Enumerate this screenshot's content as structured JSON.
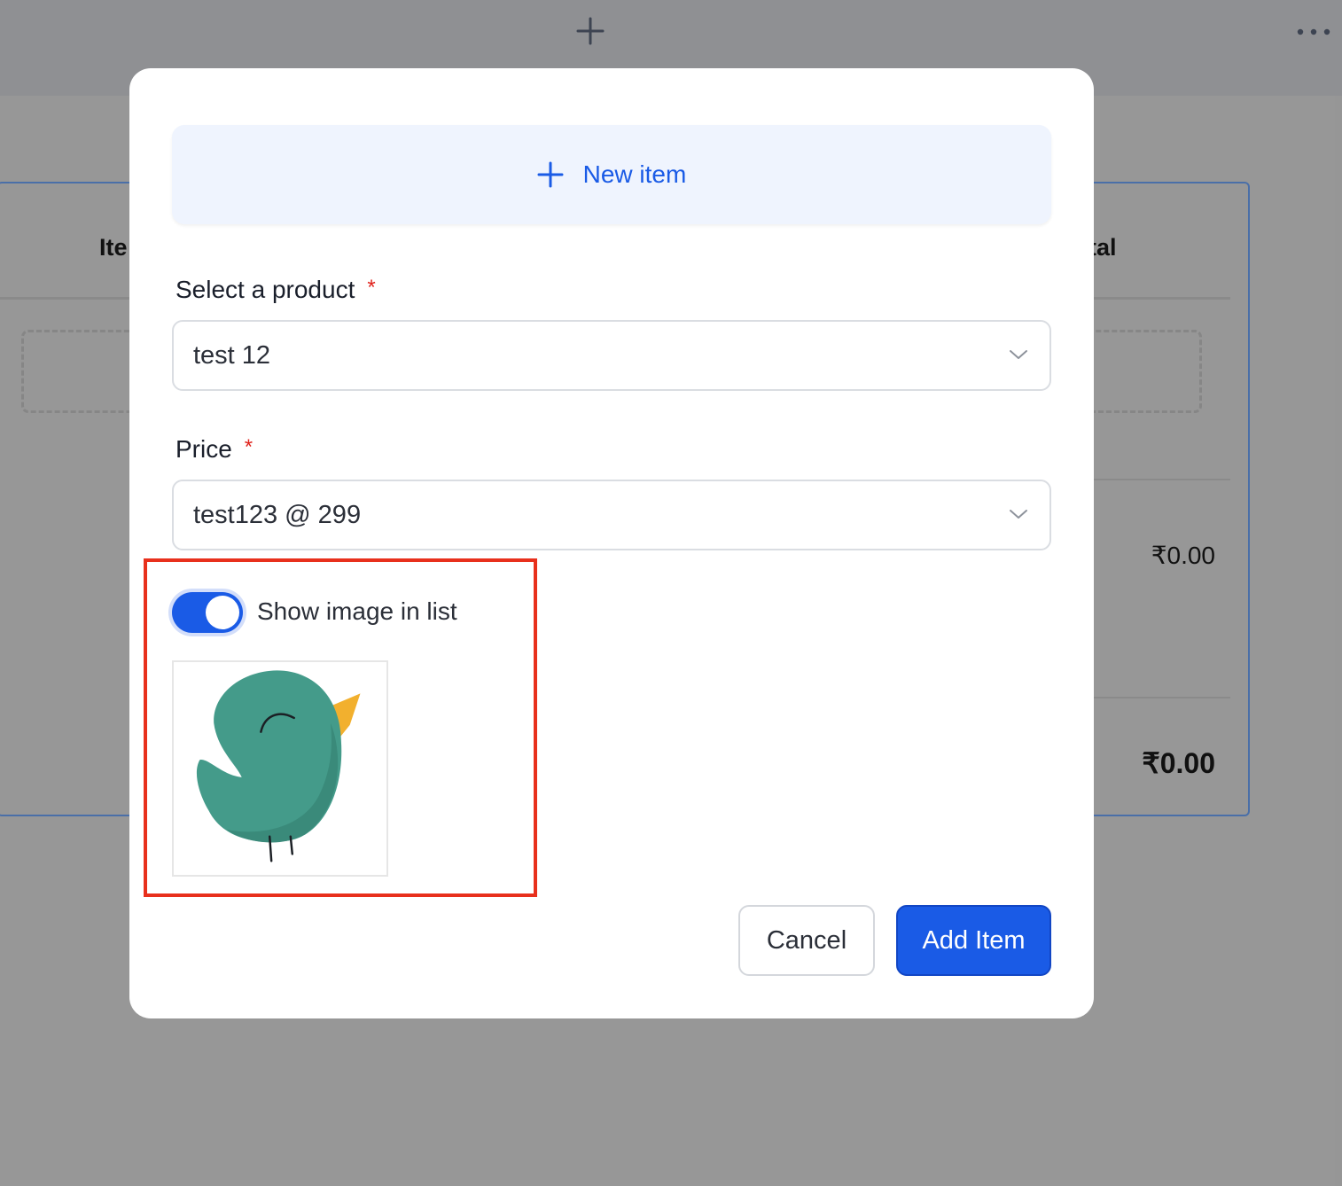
{
  "background": {
    "table_header_left": "Ite",
    "table_header_right": "tal",
    "row_amount": "₹0.00",
    "total_amount": "₹0.00"
  },
  "modal": {
    "new_item_label": "New item",
    "product_field": {
      "label": "Select a product",
      "required_mark": "*",
      "value": "test 12"
    },
    "price_field": {
      "label": "Price",
      "required_mark": "*",
      "value": "test123 @ 299"
    },
    "show_image_toggle": {
      "label": "Show image in list",
      "checked": true
    },
    "preview_image": "bird-illustration",
    "cancel_label": "Cancel",
    "add_label": "Add Item"
  },
  "colors": {
    "accent": "#1a5be6",
    "highlight_border": "#e8301c",
    "required": "#e0231c",
    "bird_body": "#449b8a",
    "bird_beak": "#f2b02e"
  },
  "icons": [
    "plus-icon",
    "more-dots-icon",
    "chevron-down-icon"
  ]
}
